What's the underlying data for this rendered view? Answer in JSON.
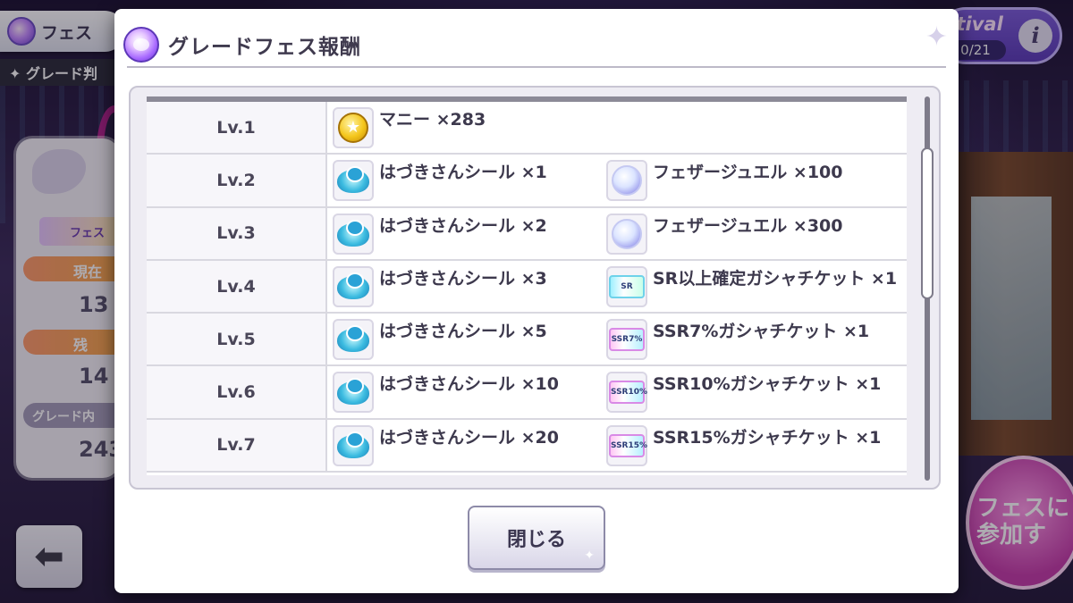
{
  "background": {
    "top_left_label": "フェス",
    "grade_label": "✦ グレード判",
    "fes_tag": "フェス",
    "bar1_label": "現在",
    "bar1_value": "13",
    "bar2_label": "残",
    "bar2_value": "14",
    "grade_bar_label": "グレード内",
    "grade_bar_value": "243",
    "festival_word": "stival",
    "festival_count": "0/21",
    "info_glyph": "i",
    "join_button_text": "フェスに参加す",
    "back_arrow": "⬅"
  },
  "modal": {
    "title": "グレードフェス報酬",
    "sparkle": "✦",
    "close_label": "閉じる"
  },
  "rewards": [
    {
      "level": "Lv.1",
      "item1": {
        "icon": "coin-icon",
        "label": "マニー ×283"
      },
      "item2": null
    },
    {
      "level": "Lv.2",
      "item1": {
        "icon": "seal-icon",
        "label": "はづきさんシール ×1"
      },
      "item2": {
        "icon": "jewel-icon",
        "label": "フェザージュエル ×100"
      }
    },
    {
      "level": "Lv.3",
      "item1": {
        "icon": "seal-icon",
        "label": "はづきさんシール ×2"
      },
      "item2": {
        "icon": "jewel-icon",
        "label": "フェザージュエル ×300"
      }
    },
    {
      "level": "Lv.4",
      "item1": {
        "icon": "seal-icon",
        "label": "はづきさんシール ×3"
      },
      "item2": {
        "icon": "sr-ticket-icon",
        "label": "SR以上確定ガシャチケット ×1"
      }
    },
    {
      "level": "Lv.5",
      "item1": {
        "icon": "seal-icon",
        "label": "はづきさんシール ×5"
      },
      "item2": {
        "icon": "ssr-ticket-icon",
        "label": "SSR7%ガシャチケット ×1"
      }
    },
    {
      "level": "Lv.6",
      "item1": {
        "icon": "seal-icon",
        "label": "はづきさんシール ×10"
      },
      "item2": {
        "icon": "ssr-ticket-icon",
        "label": "SSR10%ガシャチケット ×1"
      }
    },
    {
      "level": "Lv.7",
      "item1": {
        "icon": "seal-icon",
        "label": "はづきさんシール ×20"
      },
      "item2": {
        "icon": "ssr-ticket-icon",
        "label": "SSR15%ガシャチケット ×1"
      }
    }
  ],
  "ticket_texts": {
    "sr": "SR",
    "ssr7": "SSR7%",
    "ssr10": "SSR10%",
    "ssr15": "SSR15%"
  },
  "coin_glyph": "★",
  "scroll_position": 0.22
}
